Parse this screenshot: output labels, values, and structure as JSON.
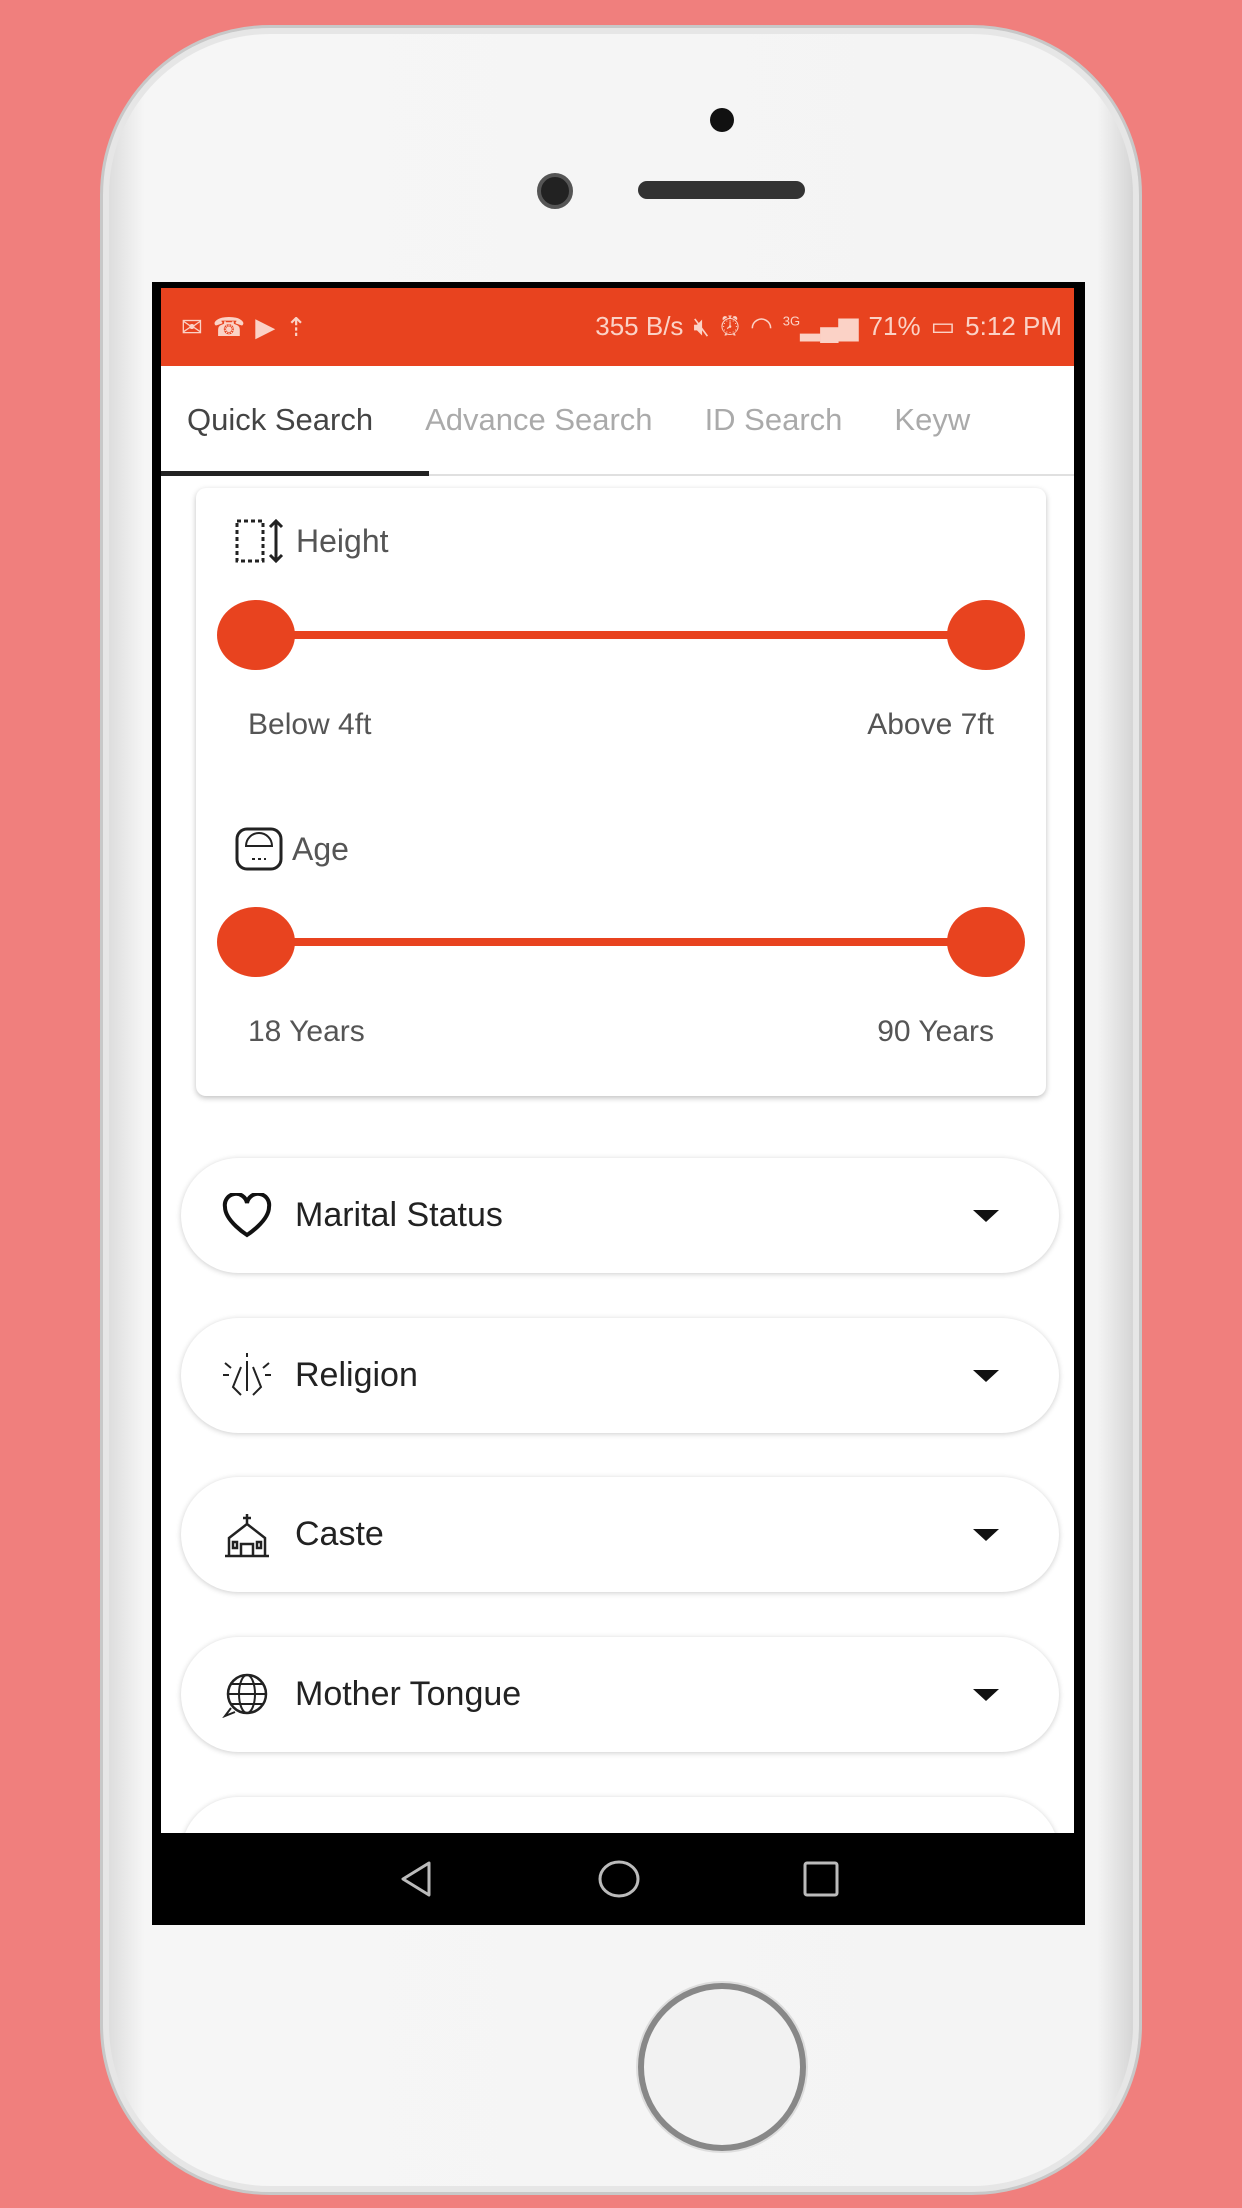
{
  "colors": {
    "accent": "#e8431f",
    "background": "#f07f7d"
  },
  "status_bar": {
    "left_icons": [
      "mail-icon",
      "missed-call-icon",
      "youtube-icon",
      "signal-boost-icon"
    ],
    "speed": "355 B/s",
    "signal": "3G",
    "battery": "71%",
    "time": "5:12 PM"
  },
  "tabs": [
    {
      "label": "Quick Search",
      "active": true
    },
    {
      "label": "Advance Search"
    },
    {
      "label": "ID Search"
    },
    {
      "label": "Keyw"
    }
  ],
  "filters": {
    "height": {
      "label": "Height",
      "min": "Below 4ft",
      "max": "Above 7ft",
      "range_selected": [
        0,
        1
      ]
    },
    "age": {
      "label": "Age",
      "min": "18 Years",
      "max": "90 Years",
      "range_selected": [
        0,
        1
      ]
    }
  },
  "dropdowns": [
    {
      "label": "Marital Status",
      "icon": "heart-icon"
    },
    {
      "label": "Religion",
      "icon": "praying-hands-icon"
    },
    {
      "label": "Caste",
      "icon": "temple-icon"
    },
    {
      "label": "Mother Tongue",
      "icon": "globe-chat-icon"
    }
  ]
}
